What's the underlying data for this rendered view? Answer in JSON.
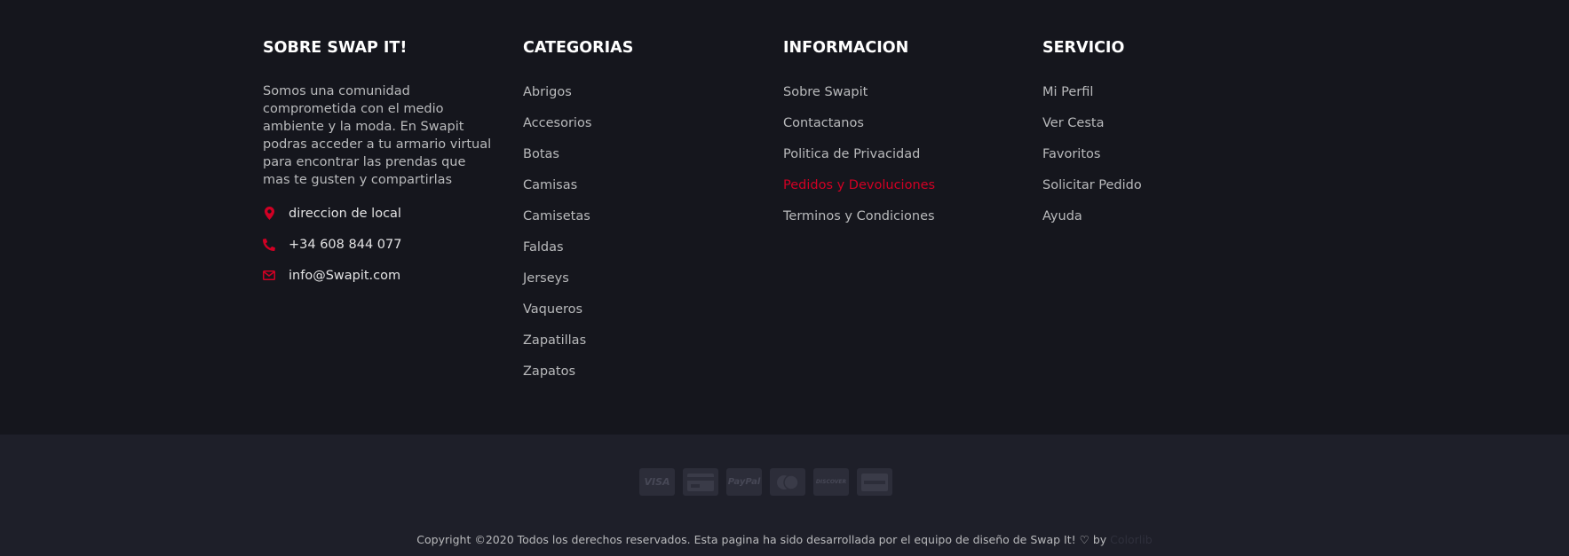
{
  "colors": {
    "background": "#15161d",
    "bottom_background": "#1e1f29",
    "accent": "#d10024",
    "text": "#b9babc",
    "heading": "#ffffff"
  },
  "about": {
    "title": "SOBRE SWAP IT!",
    "text": "Somos una comunidad comprometida con el medio ambiente y la moda. En Swapit podras acceder a tu armario virtual para encontrar las prendas que mas te gusten y compartirlas",
    "contacts": [
      {
        "icon": "map-marker-icon",
        "label": "direccion de local"
      },
      {
        "icon": "phone-icon",
        "label": "+34 608 844 077"
      },
      {
        "icon": "envelope-icon",
        "label": "info@Swapit.com"
      }
    ]
  },
  "categorias": {
    "title": "CATEGORIAS",
    "items": [
      "Abrigos",
      "Accesorios",
      "Botas",
      "Camisas",
      "Camisetas",
      "Faldas",
      "Jerseys",
      "Vaqueros",
      "Zapatillas",
      "Zapatos"
    ]
  },
  "informacion": {
    "title": "INFORMACION",
    "items": [
      "Sobre Swapit",
      "Contactanos",
      "Politica de Privacidad",
      "Pedidos y Devoluciones",
      "Terminos y Condiciones"
    ],
    "active_item": "Pedidos y Devoluciones"
  },
  "servicio": {
    "title": "SERVICIO",
    "items": [
      "Mi Perfil",
      "Ver Cesta",
      "Favoritos",
      "Solicitar Pedido",
      "Ayuda"
    ]
  },
  "payments": [
    {
      "icon": "visa-icon",
      "label": "VISA"
    },
    {
      "icon": "credit-card-icon",
      "label": ""
    },
    {
      "icon": "paypal-icon",
      "label": "PayPal"
    },
    {
      "icon": "mastercard-icon",
      "label": ""
    },
    {
      "icon": "discover-icon",
      "label": "DISCOVER"
    },
    {
      "icon": "amex-icon",
      "label": ""
    }
  ],
  "copyright": {
    "text": "Copyright ©2020 Todos los derechos reservados. Esta pagina ha sido desarrollada por el equipo de diseño de Swap It!",
    "by": "by",
    "link": "Colorlib"
  }
}
